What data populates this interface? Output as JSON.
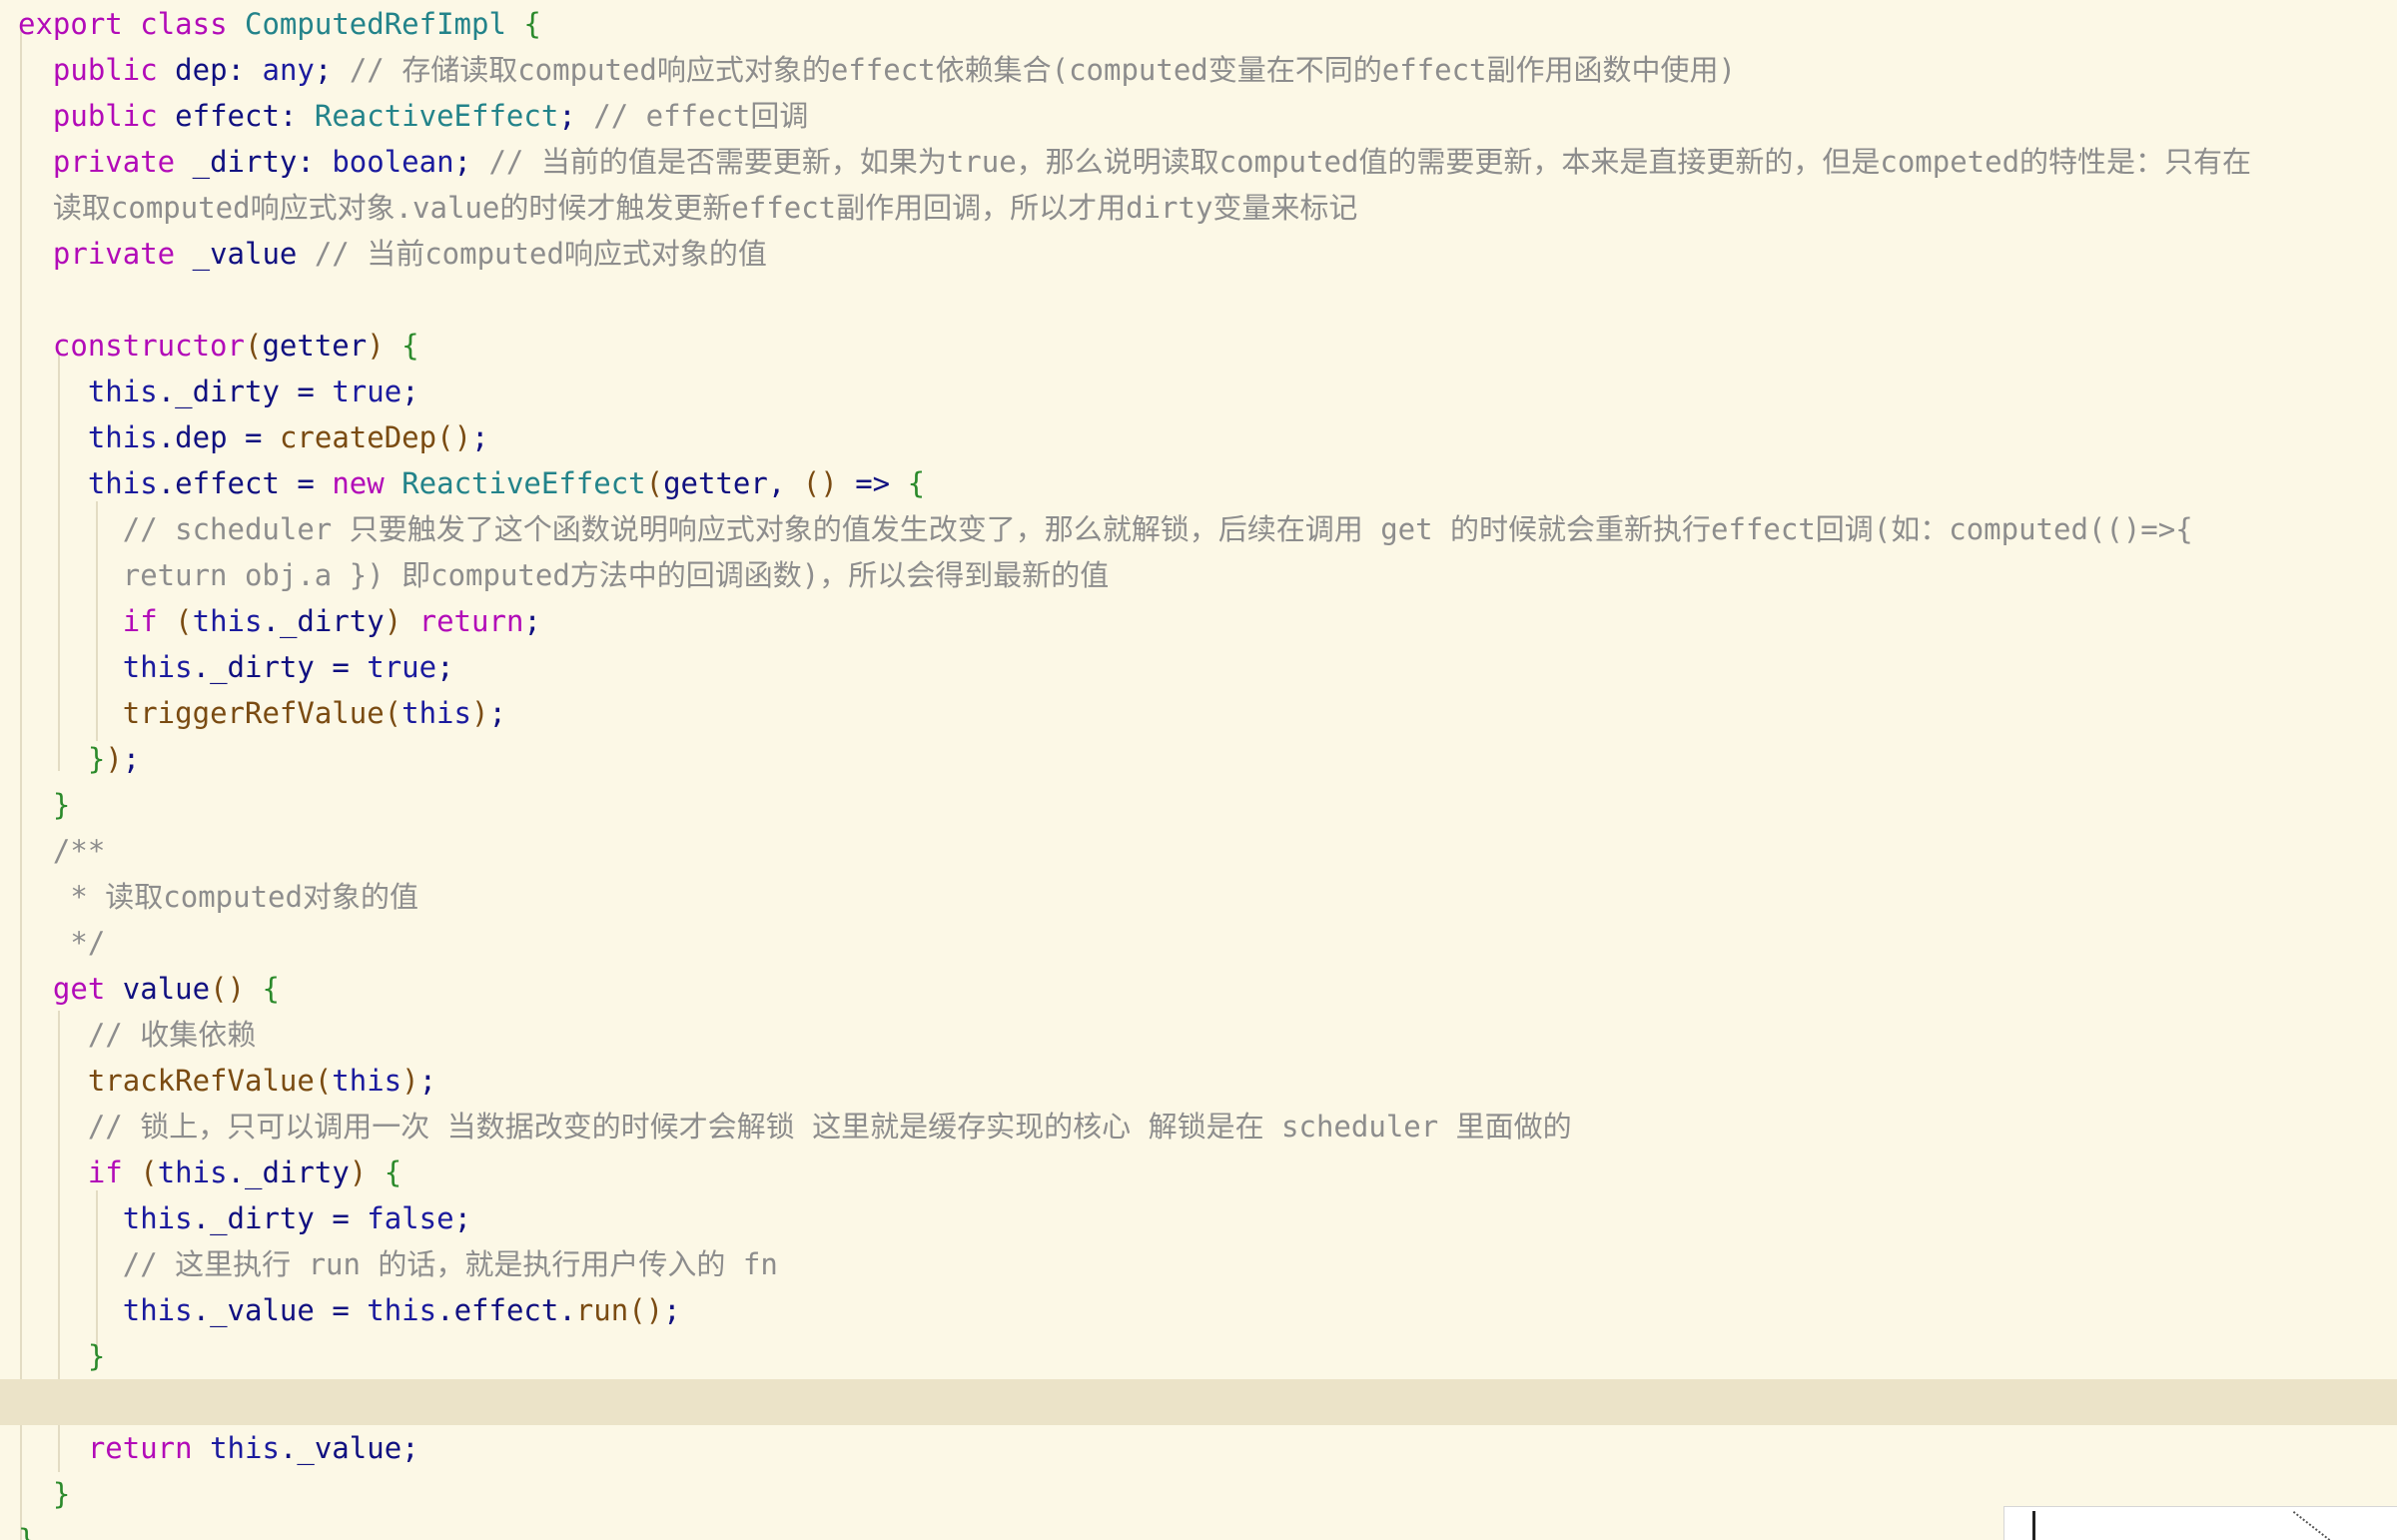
{
  "editor": {
    "language": "typescript",
    "current_line_index": 30,
    "lines": [
      "export class ComputedRefImpl {",
      "  public dep: any; // 存储读取computed响应式对象的effect依赖集合(computed变量在不同的effect副作用函数中使用)",
      "  public effect: ReactiveEffect; // effect回调",
      "  private _dirty: boolean; // 当前的值是否需要更新，如果为true，那么说明读取computed值的需要更新，本来是直接更新的，但是competed的特性是：只有在",
      "  读取computed响应式对象.value的时候才触发更新effect副作用回调，所以才用dirty变量来标记",
      "  private _value // 当前computed响应式对象的值",
      "",
      "  constructor(getter) {",
      "    this._dirty = true;",
      "    this.dep = createDep();",
      "    this.effect = new ReactiveEffect(getter, () => {",
      "      // scheduler 只要触发了这个函数说明响应式对象的值发生改变了，那么就解锁，后续在调用 get 的时候就会重新执行effect回调(如：computed(()=>{",
      "      return obj.a }) 即computed方法中的回调函数)，所以会得到最新的值",
      "      if (this._dirty) return;",
      "      this._dirty = true;",
      "      triggerRefValue(this);",
      "    });",
      "  }",
      "  /**",
      "   * 读取computed对象的值",
      "   */",
      "  get value() {",
      "    // 收集依赖",
      "    trackRefValue(this);",
      "    // 锁上，只可以调用一次 当数据改变的时候才会解锁 这里就是缓存实现的核心 解锁是在 scheduler 里面做的",
      "    if (this._dirty) {",
      "      this._dirty = false;",
      "      // 这里执行 run 的话，就是执行用户传入的 fn",
      "      this._value = this.effect.run();",
      "    }",
      "",
      "    return this._value;",
      "  }",
      "}"
    ]
  }
}
